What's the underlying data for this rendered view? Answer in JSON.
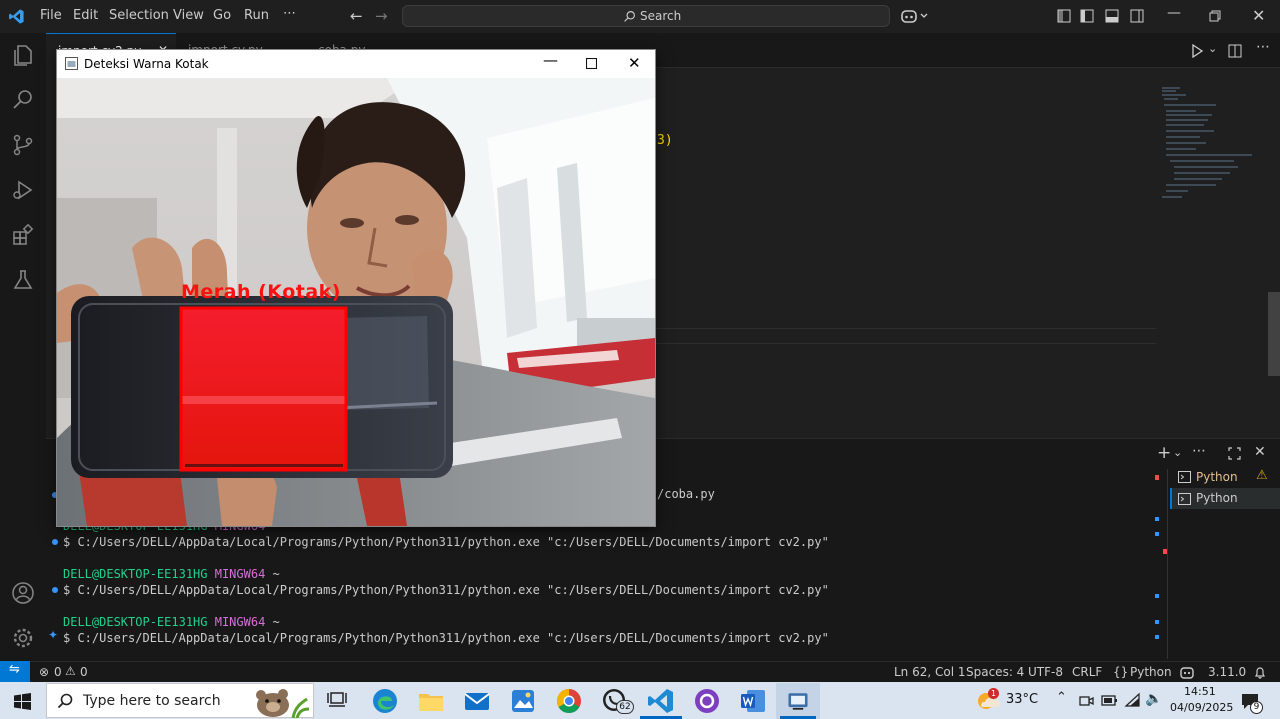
{
  "menu": [
    "File",
    "Edit",
    "Selection",
    "View",
    "Go",
    "Run",
    "⋯"
  ],
  "search": {
    "label": "Search"
  },
  "tabs": [
    "import cv2.py",
    "import cv.py",
    "coba.py"
  ],
  "code_fragment": "3)",
  "cv_window": {
    "title": "Deteksi Warna Kotak",
    "detection_label": "Merah (Kotak)",
    "colors": {
      "label": "#ff1010",
      "box_border": "#ff0000",
      "box_fill": "#ef1414"
    }
  },
  "terminal": {
    "lines": [
      {
        "type": "path-end",
        "text": "/coba.py"
      },
      {
        "type": "prompt",
        "user": "DELL@DESKTOP-EE131HG",
        "shell": "MINGW64",
        "dir": "~"
      },
      {
        "type": "cmd",
        "text": "$ C:/Users/DELL/AppData/Local/Programs/Python/Python311/python.exe \"c:/Users/DELL/Documents/import cv2.py\""
      },
      {
        "type": "prompt",
        "user": "DELL@DESKTOP-EE131HG",
        "shell": "MINGW64",
        "dir": "~"
      },
      {
        "type": "cmd",
        "text": "$ C:/Users/DELL/AppData/Local/Programs/Python/Python311/python.exe \"c:/Users/DELL/Documents/import cv2.py\""
      },
      {
        "type": "prompt",
        "user": "DELL@DESKTOP-EE131HG",
        "shell": "MINGW64",
        "dir": "~"
      },
      {
        "type": "cmd",
        "text": "$ C:/Users/DELL/AppData/Local/Programs/Python/Python311/python.exe \"c:/Users/DELL/Documents/import cv2.py\""
      }
    ],
    "sessions": [
      {
        "label": "Python",
        "warning": true
      },
      {
        "label": "Python",
        "active": true
      }
    ]
  },
  "statusbar": {
    "errors": "0",
    "warnings": "0",
    "position": "Ln 62, Col 1",
    "spaces": "Spaces: 4",
    "encoding": "UTF-8",
    "eol": "CRLF",
    "language": "Python",
    "python_version": "3.11.0"
  },
  "taskbar": {
    "search_placeholder": "Type here to search",
    "whatsapp_badge": "62",
    "weather": "33°C",
    "weather_alert": "1",
    "time": "14:51",
    "date": "04/09/2025",
    "notifications": "9"
  },
  "colors": {
    "accent": "#0078d4",
    "terminal_green": "#23d18b",
    "terminal_purple": "#d670d6"
  }
}
